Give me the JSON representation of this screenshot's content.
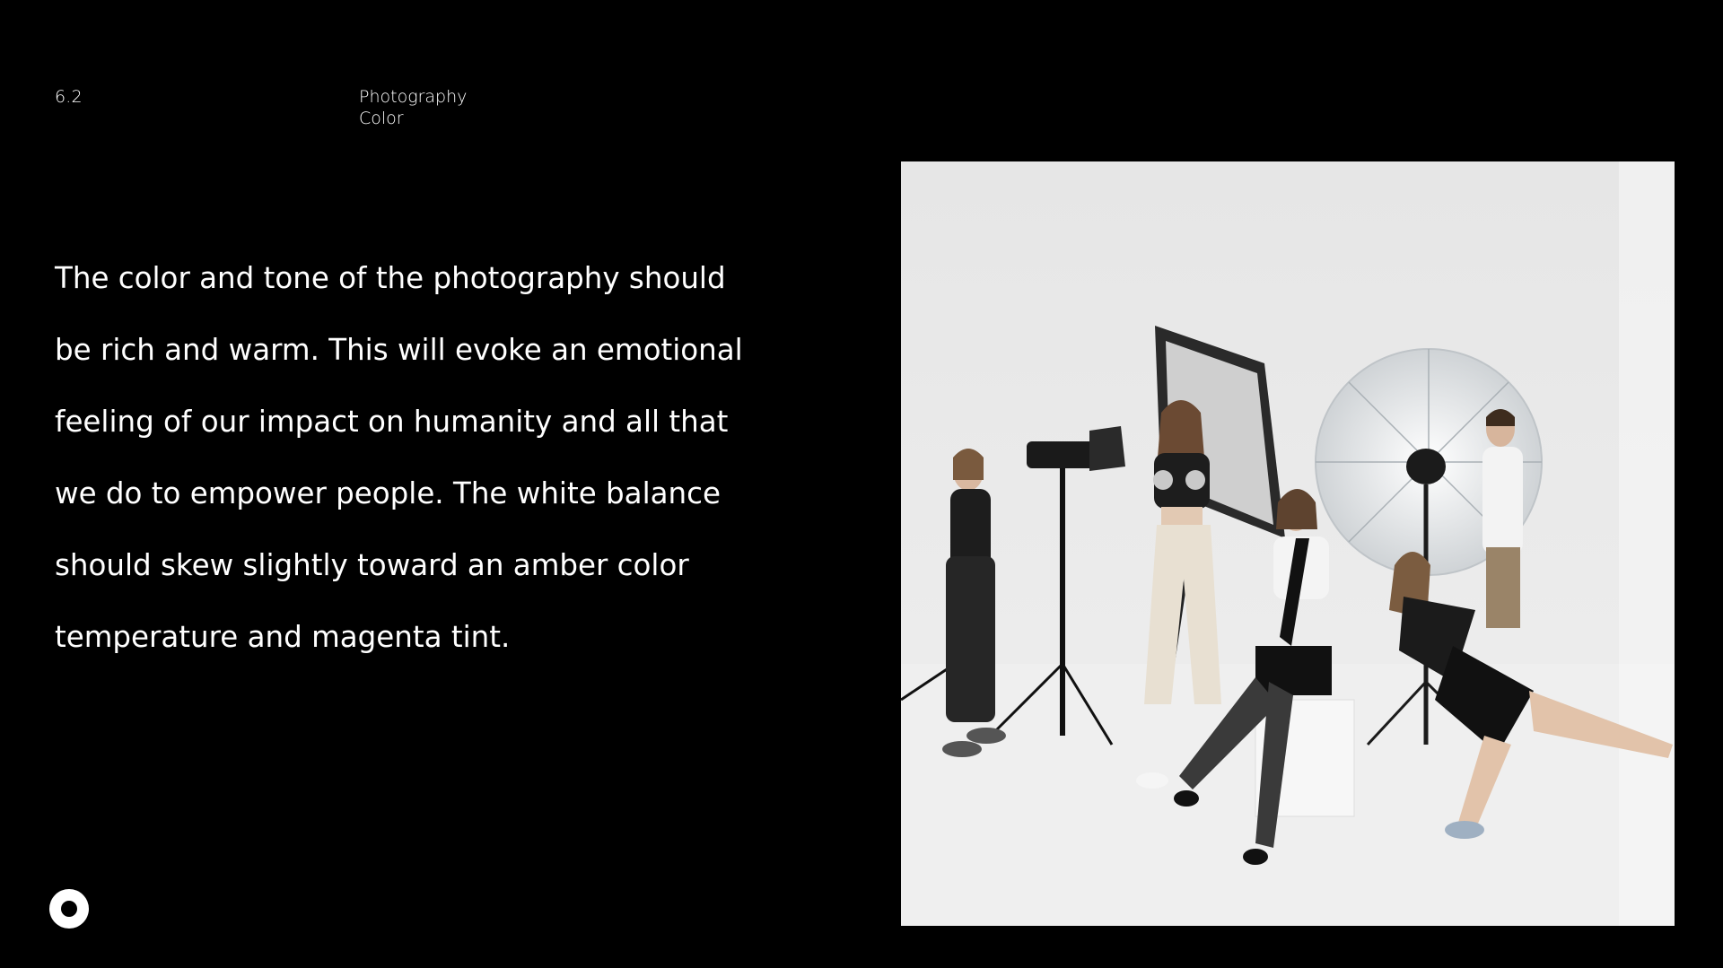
{
  "header": {
    "section_number": "6.2",
    "section_title": "Photography",
    "section_subtitle": "Color"
  },
  "main": {
    "body_lines": [
      "The color and tone of the photography should",
      "be rich and warm. This will evoke an emotional",
      "feeling of our impact on humanity and all that",
      "we do to empower people. The white balance",
      "should skew slightly toward an amber color",
      "temperature and magenta tint."
    ]
  },
  "footer": {
    "logo_icon": "ring-logo-icon"
  },
  "photo": {
    "subject": "studio-photo-group-with-lights"
  },
  "colors": {
    "background": "#000000",
    "text": "#ffffff",
    "photo_backdrop": "#eeeeee"
  }
}
